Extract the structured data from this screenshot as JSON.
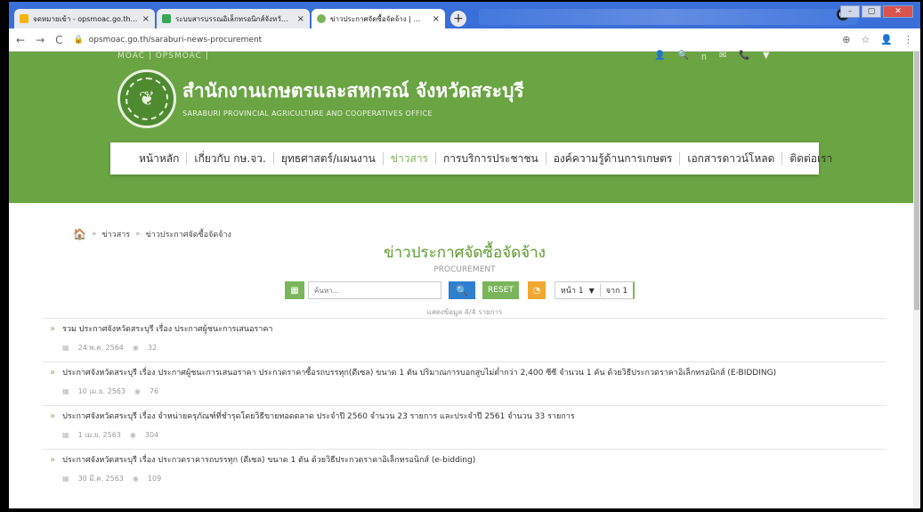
{
  "browser": {
    "tabs": [
      {
        "title": "จดหมายเข้า - opsmoac.go.th - Sm",
        "favicon_color": "#f4b400"
      },
      {
        "title": "ระบบสารบรรณอิเล็กทรอนิกส์จังหวัดสระ",
        "favicon_color": "#34a853"
      },
      {
        "title": "ข่าวประกาศจัดซื้อจัดจ้าง | สำนักงานเกษ",
        "favicon_color": "#7bb55b"
      }
    ],
    "close_glyph": "×",
    "new_tab_glyph": "+",
    "url": "opsmoac.go.th/saraburi-news-procurement",
    "window_controls": [
      "–",
      "▢",
      "✕"
    ]
  },
  "site": {
    "top_left": "MOAC | OPSMOAC |",
    "top_right_icons": [
      "👤",
      "🔍",
      "ก",
      "✉",
      "📞",
      "▼"
    ],
    "title": "สำนักงานเกษตรและสหกรณ์ จังหวัดสระบุรี",
    "subtitle": "SARABURI PROVINCIAL AGRICULTURE AND COOPERATIVES OFFICE",
    "nav": [
      "หน้าหลัก",
      "เกี่ยวกับ กษ.จว.",
      "ยุทธศาสตร์/แผนงาน",
      "ข่าวสาร",
      "การบริการประชาชน",
      "องค์ความรู้ด้านการเกษตร",
      "เอกสารดาวน์โหลด",
      "ติดต่อเรา"
    ],
    "active_nav": "ข่าวสาร"
  },
  "breadcrumb": {
    "items": [
      "ข่าวสาร",
      "ข่าวประกาศจัดซื้อจัดจ้าง"
    ]
  },
  "page": {
    "title": "ข่าวประกาศจัดซื้อจัดจ้าง",
    "subtitle": "PROCUREMENT",
    "search_placeholder": "ค้นหา...",
    "reset_label": "RESET",
    "page_label": "หน้า 1",
    "of_label": "จาก 1",
    "count_label": "แสดงข้อมูล 4/4 รายการ"
  },
  "items": [
    {
      "title": "รวม ประกาศจังหวัดสระบุรี เรื่อง ประกาศผู้ชนะการเสนอราคา",
      "date": "24 พ.ค. 2564",
      "views": "32"
    },
    {
      "title": "ประกาศจังหวัดสระบุรี เรื่อง ประกาศผู้ชนะการเสนอราคา ประกวดราคาซื้อรถบรรทุก(ดีเซล) ขนาด 1 ตัน ปริมาณการบอกสูบไม่ต่ำกว่า 2,400 ซีซี จำนวน 1 คัน ด้วยวิธีประกวดราคาอิเล็กทรอนิกส์ (E-BIDDING)",
      "date": "10 เม.ย. 2563",
      "views": "76"
    },
    {
      "title": "ประกาศจังหวัดสระบุรี เรื่อง จำหน่ายครุภัณฑ์ที่ชำรุดโดยวิธีขายทอดตลาด ประจำปี 2560 จำนวน 23 รายการ และประจำปี 2561 จำนวน 33 รายการ",
      "date": "1 เม.ย. 2563",
      "views": "304"
    },
    {
      "title": "ประกาศจังหวัดสระบุรี เรื่อง ประกวดราคารถบรรทุก (ดีเซล) ขนาด 1 ตัน ด้วยวิธีประกวดราคาอิเล็กทรอนิกส์ (e-bidding)",
      "date": "30 มี.ค. 2563",
      "views": "109"
    }
  ]
}
